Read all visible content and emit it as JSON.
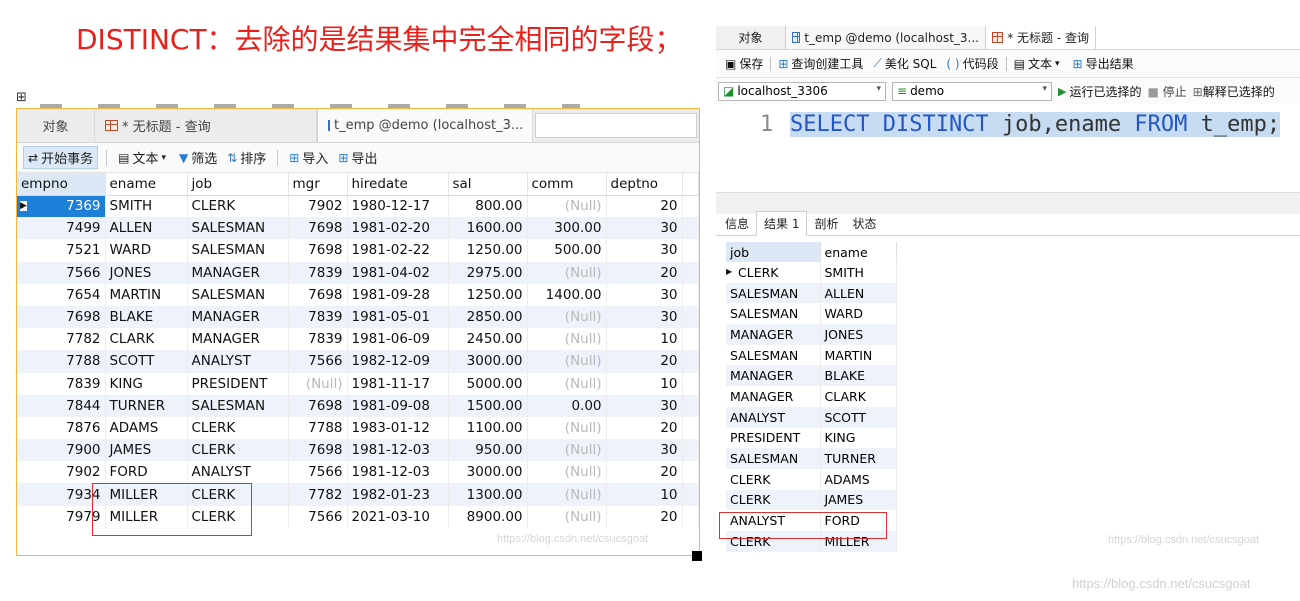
{
  "heading": "DISTINCT：去除的是结果集中完全相同的字段；",
  "left": {
    "tabs": {
      "objects": "对象",
      "query": "* 无标题 - 查询",
      "table": "t_emp @demo (localhost_3..."
    },
    "toolbar": {
      "begin_tx": "开始事务",
      "text": "文本",
      "filter": "筛选",
      "sort": "排序",
      "import": "导入",
      "export": "导出"
    },
    "columns": [
      "empno",
      "ename",
      "job",
      "mgr",
      "hiredate",
      "sal",
      "comm",
      "deptno"
    ],
    "rows": [
      [
        "7369",
        "SMITH",
        "CLERK",
        "7902",
        "1980-12-17",
        "800.00",
        "(Null)",
        "20"
      ],
      [
        "7499",
        "ALLEN",
        "SALESMAN",
        "7698",
        "1981-02-20",
        "1600.00",
        "300.00",
        "30"
      ],
      [
        "7521",
        "WARD",
        "SALESMAN",
        "7698",
        "1981-02-22",
        "1250.00",
        "500.00",
        "30"
      ],
      [
        "7566",
        "JONES",
        "MANAGER",
        "7839",
        "1981-04-02",
        "2975.00",
        "(Null)",
        "20"
      ],
      [
        "7654",
        "MARTIN",
        "SALESMAN",
        "7698",
        "1981-09-28",
        "1250.00",
        "1400.00",
        "30"
      ],
      [
        "7698",
        "BLAKE",
        "MANAGER",
        "7839",
        "1981-05-01",
        "2850.00",
        "(Null)",
        "30"
      ],
      [
        "7782",
        "CLARK",
        "MANAGER",
        "7839",
        "1981-06-09",
        "2450.00",
        "(Null)",
        "10"
      ],
      [
        "7788",
        "SCOTT",
        "ANALYST",
        "7566",
        "1982-12-09",
        "3000.00",
        "(Null)",
        "20"
      ],
      [
        "7839",
        "KING",
        "PRESIDENT",
        "(Null)",
        "1981-11-17",
        "5000.00",
        "(Null)",
        "10"
      ],
      [
        "7844",
        "TURNER",
        "SALESMAN",
        "7698",
        "1981-09-08",
        "1500.00",
        "0.00",
        "30"
      ],
      [
        "7876",
        "ADAMS",
        "CLERK",
        "7788",
        "1983-01-12",
        "1100.00",
        "(Null)",
        "20"
      ],
      [
        "7900",
        "JAMES",
        "CLERK",
        "7698",
        "1981-12-03",
        "950.00",
        "(Null)",
        "30"
      ],
      [
        "7902",
        "FORD",
        "ANALYST",
        "7566",
        "1981-12-03",
        "3000.00",
        "(Null)",
        "20"
      ],
      [
        "7934",
        "MILLER",
        "CLERK",
        "7782",
        "1982-01-23",
        "1300.00",
        "(Null)",
        "10"
      ],
      [
        "7979",
        "MILLER",
        "CLERK",
        "7566",
        "2021-03-10",
        "8900.00",
        "(Null)",
        "20"
      ]
    ],
    "watermark": "https://blog.csdn.net/csucsgoat"
  },
  "right": {
    "tabs": {
      "objects": "对象",
      "table": "t_emp @demo (localhost_3...",
      "query": "* 无标题 - 查询"
    },
    "toolbar": {
      "save": "保存",
      "builder": "查询创建工具",
      "beautify": "美化 SQL",
      "snippet": "代码段",
      "text": "文本",
      "export": "导出结果"
    },
    "connection": "localhost_3306",
    "database": "demo",
    "run": "运行已选择的",
    "stop": "停止",
    "explain": "解释已选择的",
    "line_number": "1",
    "sql": {
      "kw1": "SELECT DISTINCT",
      "mid": " job,ename ",
      "kw2": "FROM",
      "tail": " t_emp;"
    },
    "result_tabs": [
      "信息",
      "结果 1",
      "剖析",
      "状态"
    ],
    "columns": [
      "job",
      "ename"
    ],
    "rows": [
      [
        "CLERK",
        "SMITH"
      ],
      [
        "SALESMAN",
        "ALLEN"
      ],
      [
        "SALESMAN",
        "WARD"
      ],
      [
        "MANAGER",
        "JONES"
      ],
      [
        "SALESMAN",
        "MARTIN"
      ],
      [
        "MANAGER",
        "BLAKE"
      ],
      [
        "MANAGER",
        "CLARK"
      ],
      [
        "ANALYST",
        "SCOTT"
      ],
      [
        "PRESIDENT",
        "KING"
      ],
      [
        "SALESMAN",
        "TURNER"
      ],
      [
        "CLERK",
        "ADAMS"
      ],
      [
        "CLERK",
        "JAMES"
      ],
      [
        "ANALYST",
        "FORD"
      ],
      [
        "CLERK",
        "MILLER"
      ]
    ],
    "watermark": "https://blog.csdn.net/csucsgoat"
  },
  "page_watermark": "https://blog.csdn.net/csucsgoat",
  "colors": {
    "heading": "#e8201b",
    "selection": "#1e7fd8",
    "highlight_box": "#e03030",
    "frame": "#f5b545"
  }
}
